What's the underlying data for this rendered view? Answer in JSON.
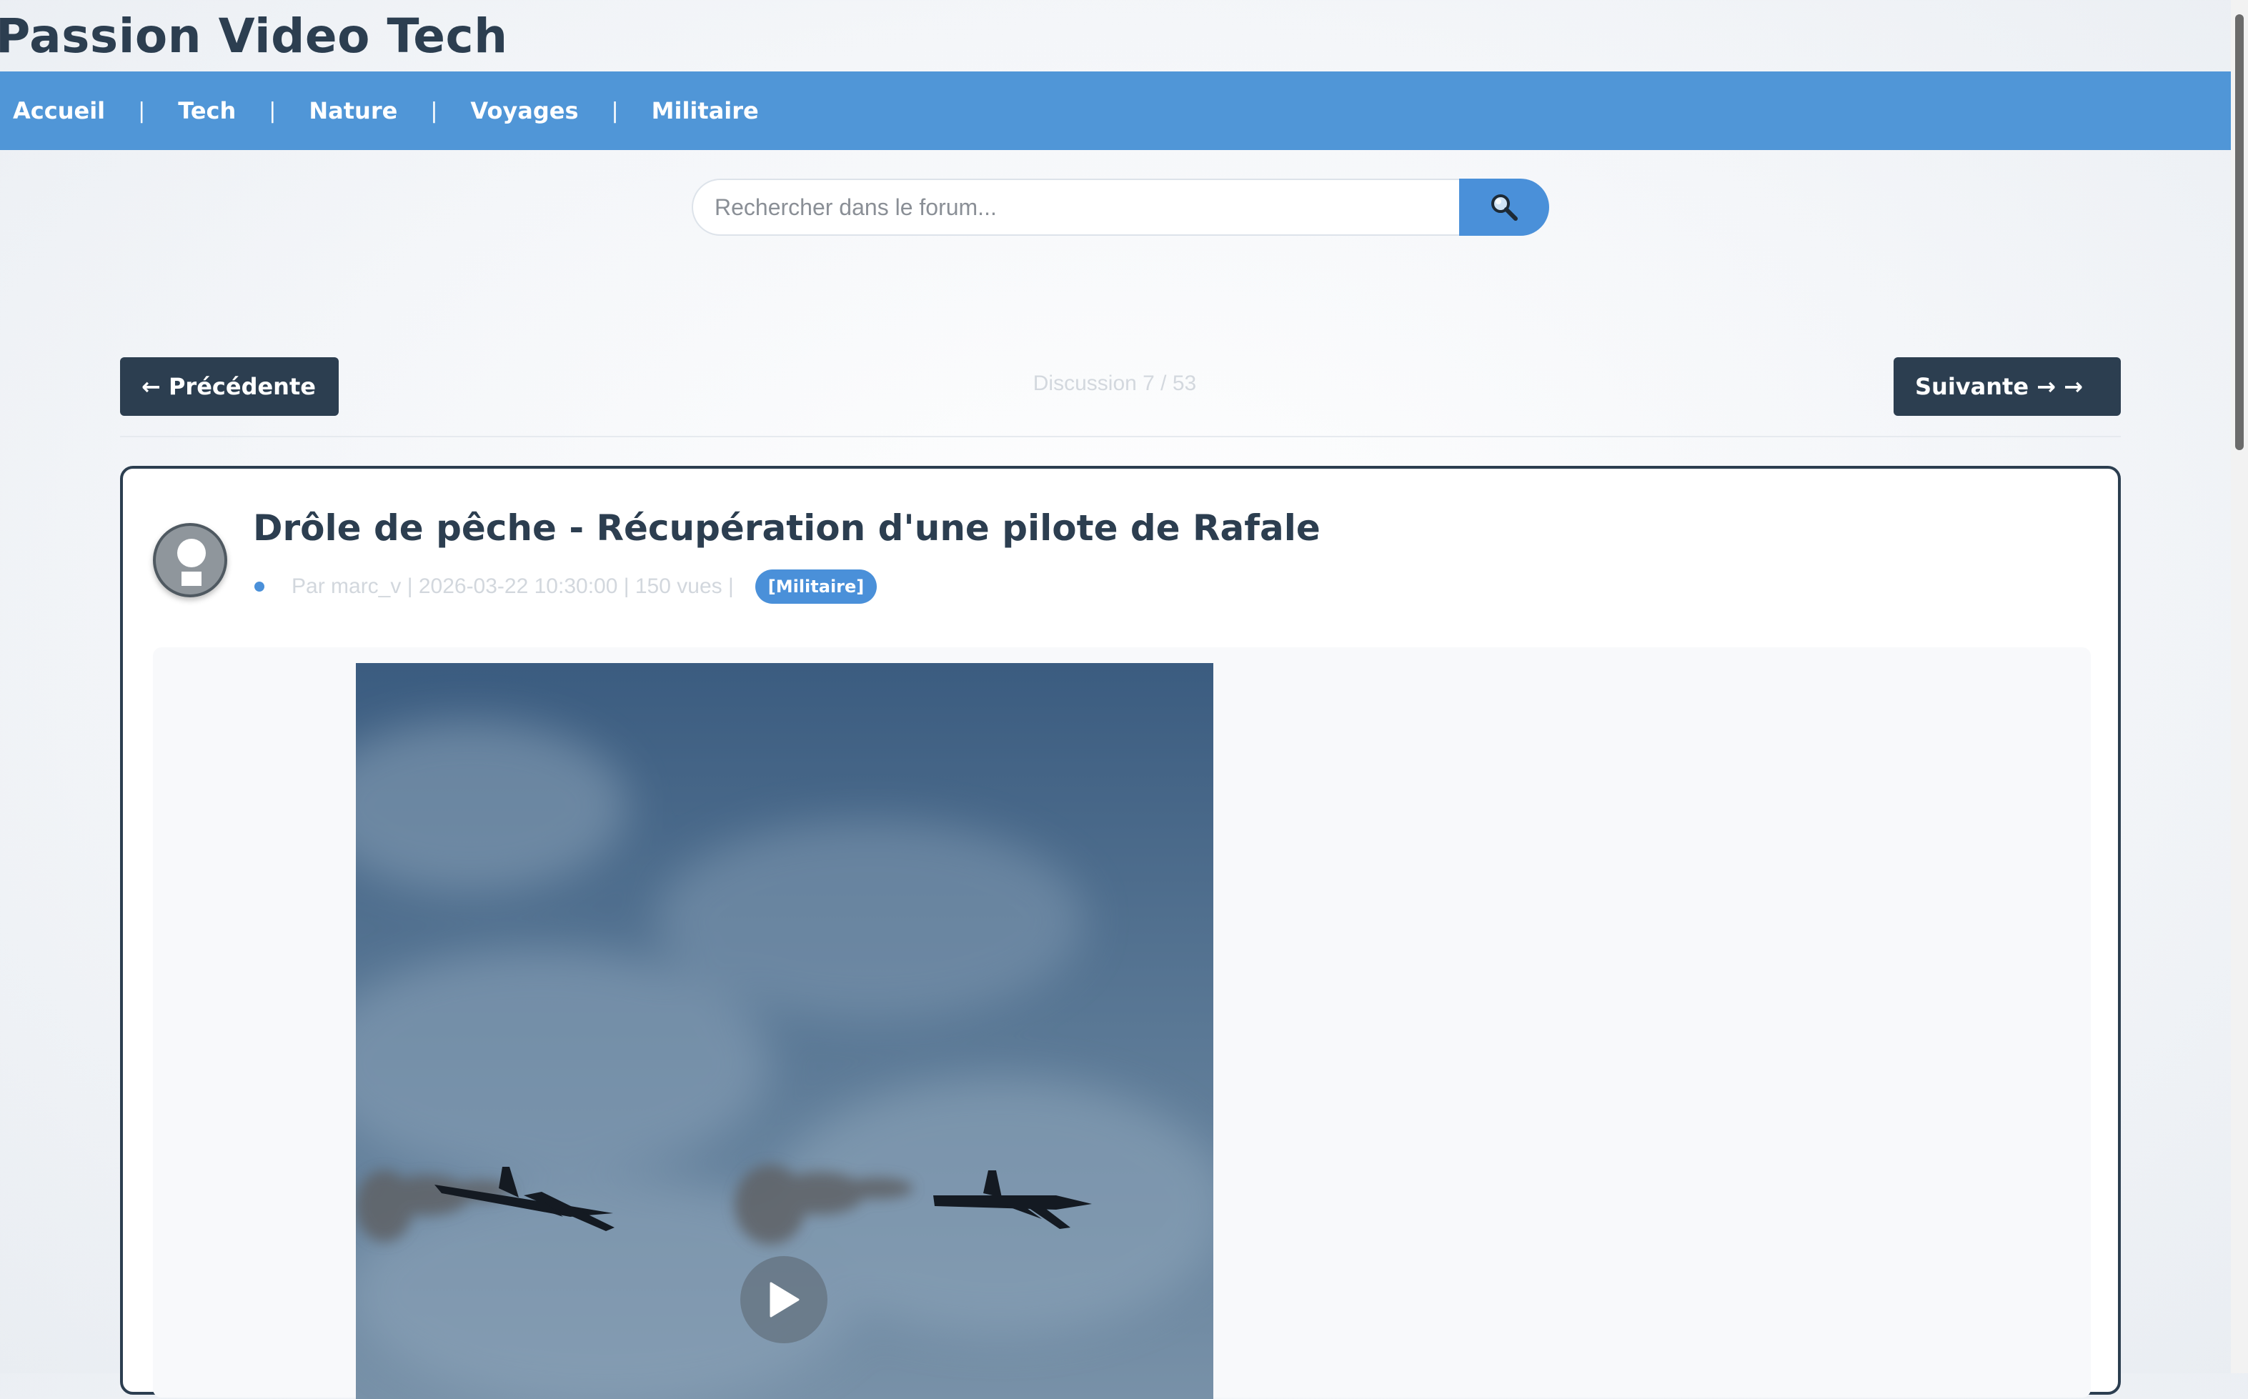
{
  "site": {
    "title": "Passion Video Tech"
  },
  "nav": {
    "items": [
      {
        "label": "Accueil"
      },
      {
        "label": "Tech"
      },
      {
        "label": "Nature"
      },
      {
        "label": "Voyages"
      },
      {
        "label": "Militaire"
      }
    ],
    "separator": "|"
  },
  "search": {
    "placeholder": "Rechercher dans le forum...",
    "button_icon": "search-icon"
  },
  "pager": {
    "prev_label": "← Précédente",
    "next_label": "Suivante →  →",
    "position_label": "Discussion 7 / 53"
  },
  "post": {
    "title": "Drôle de pêche - Récupération d'une pilote de Rafale",
    "meta": "Par marc_v | 2026-03-22 10:30:00 | 150 vues |",
    "tag": "[Militaire]",
    "avatar_icon": "user-avatar-icon",
    "video_icon": "play-icon"
  },
  "colors": {
    "nav_background": "#5096d7",
    "accent": "#4a90d9",
    "dark": "#2c3e50",
    "muted_text": "#d2d7dd"
  }
}
